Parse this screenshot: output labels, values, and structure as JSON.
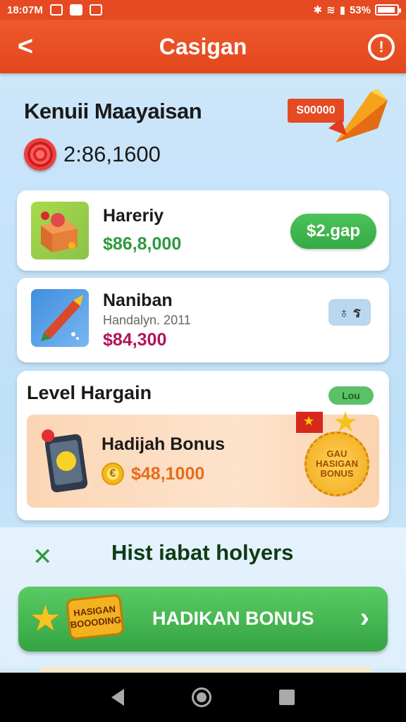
{
  "status_bar": {
    "time": "18:07M",
    "battery": "53%"
  },
  "app_bar": {
    "title": "Casigan",
    "back_glyph": "<",
    "info_glyph": "!"
  },
  "header": {
    "title": "Kenuii Maayaisan",
    "balance": "2:86,1600",
    "promo_tag": "S00000"
  },
  "items": [
    {
      "name": "Hareriy",
      "price": "$86,8,000",
      "action": "$2.gap"
    },
    {
      "name": "Naniban",
      "sub": "Handalyn. 2011",
      "price": "$84,300",
      "action": "♁ ร"
    }
  ],
  "level": {
    "title": "Level Hargain",
    "badge": "Lou",
    "bonus_name": "Hadijah Bonus",
    "coin_glyph": "€",
    "bonus_value": "$48,1000",
    "seal_lines": [
      "GAU",
      "HASIGAN",
      "BONUS"
    ]
  },
  "section": {
    "title": "Hist iabat holyers",
    "icon_glyph": "✕"
  },
  "cta": {
    "label": "HADIKAN BONUS",
    "badge_lines": [
      "HASIGAN",
      "BOOODING"
    ],
    "arrow": "›"
  },
  "colors": {
    "brand": "#e64a22",
    "green": "#36a945",
    "price_green": "#2e9a3e",
    "price_magenta": "#b3135c",
    "orange_value": "#e86b1b"
  }
}
